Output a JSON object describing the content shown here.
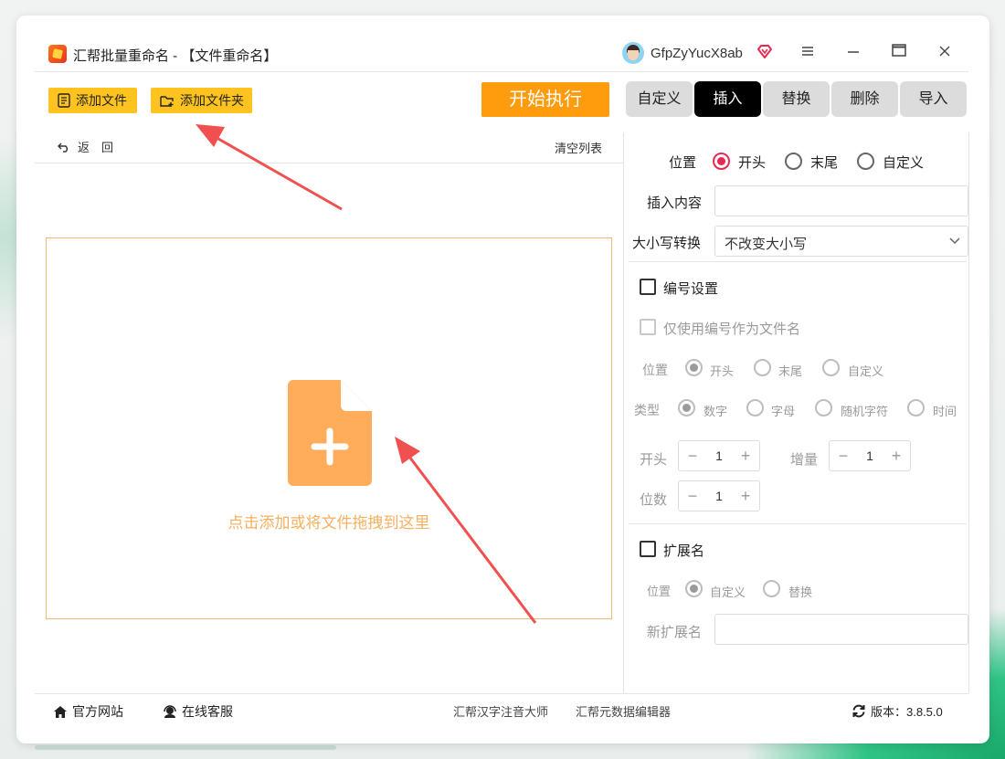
{
  "app": {
    "title": "汇帮批量重命名 - 【文件重命名】",
    "username": "GfpZyYucX8ab",
    "window_controls": [
      "menu-icon",
      "minimize-icon",
      "maximize-icon",
      "close-icon"
    ]
  },
  "toolbar": {
    "add_file": "添加文件",
    "add_folder": "添加文件夹",
    "start": "开始执行"
  },
  "tabs": [
    {
      "label": "自定义",
      "active": false
    },
    {
      "label": "插入",
      "active": true
    },
    {
      "label": "替换",
      "active": false
    },
    {
      "label": "删除",
      "active": false
    },
    {
      "label": "导入",
      "active": false
    }
  ],
  "list": {
    "back": "返　回",
    "clear": "清空列表",
    "drop_hint": "点击添加或将文件拖拽到这里"
  },
  "insert": {
    "position_label": "位置",
    "position_options": [
      "开头",
      "末尾",
      "自定义"
    ],
    "position_selected": "开头",
    "content_label": "插入内容",
    "content_value": "",
    "case_label": "大小写转换",
    "case_value": "不改变大小写"
  },
  "numbering": {
    "title": "编号设置",
    "only_number": "仅使用编号作为文件名",
    "position_label": "位置",
    "position_options": [
      "开头",
      "末尾",
      "自定义"
    ],
    "type_label": "类型",
    "type_options": [
      "数字",
      "字母",
      "随机字符",
      "时间"
    ],
    "start_label": "开头",
    "start_value": "1",
    "increment_label": "增量",
    "increment_value": "1",
    "digits_label": "位数",
    "digits_value": "1"
  },
  "extension": {
    "title": "扩展名",
    "position_label": "位置",
    "options": [
      "自定义",
      "替换"
    ],
    "new_ext_label": "新扩展名",
    "new_ext_value": ""
  },
  "footer": {
    "website": "官方网站",
    "support": "在线客服",
    "link1": "汇帮汉字注音大师",
    "link2": "汇帮元数据编辑器",
    "version": "版本：3.8.5.0"
  },
  "colors": {
    "accent_yellow": "#ffc31f",
    "start_orange": "#ff9c0d",
    "drop_border": "#f5b870",
    "file_icon": "#ffad5a",
    "radio_red": "#e8294f",
    "arrow_red": "#f0504f"
  }
}
